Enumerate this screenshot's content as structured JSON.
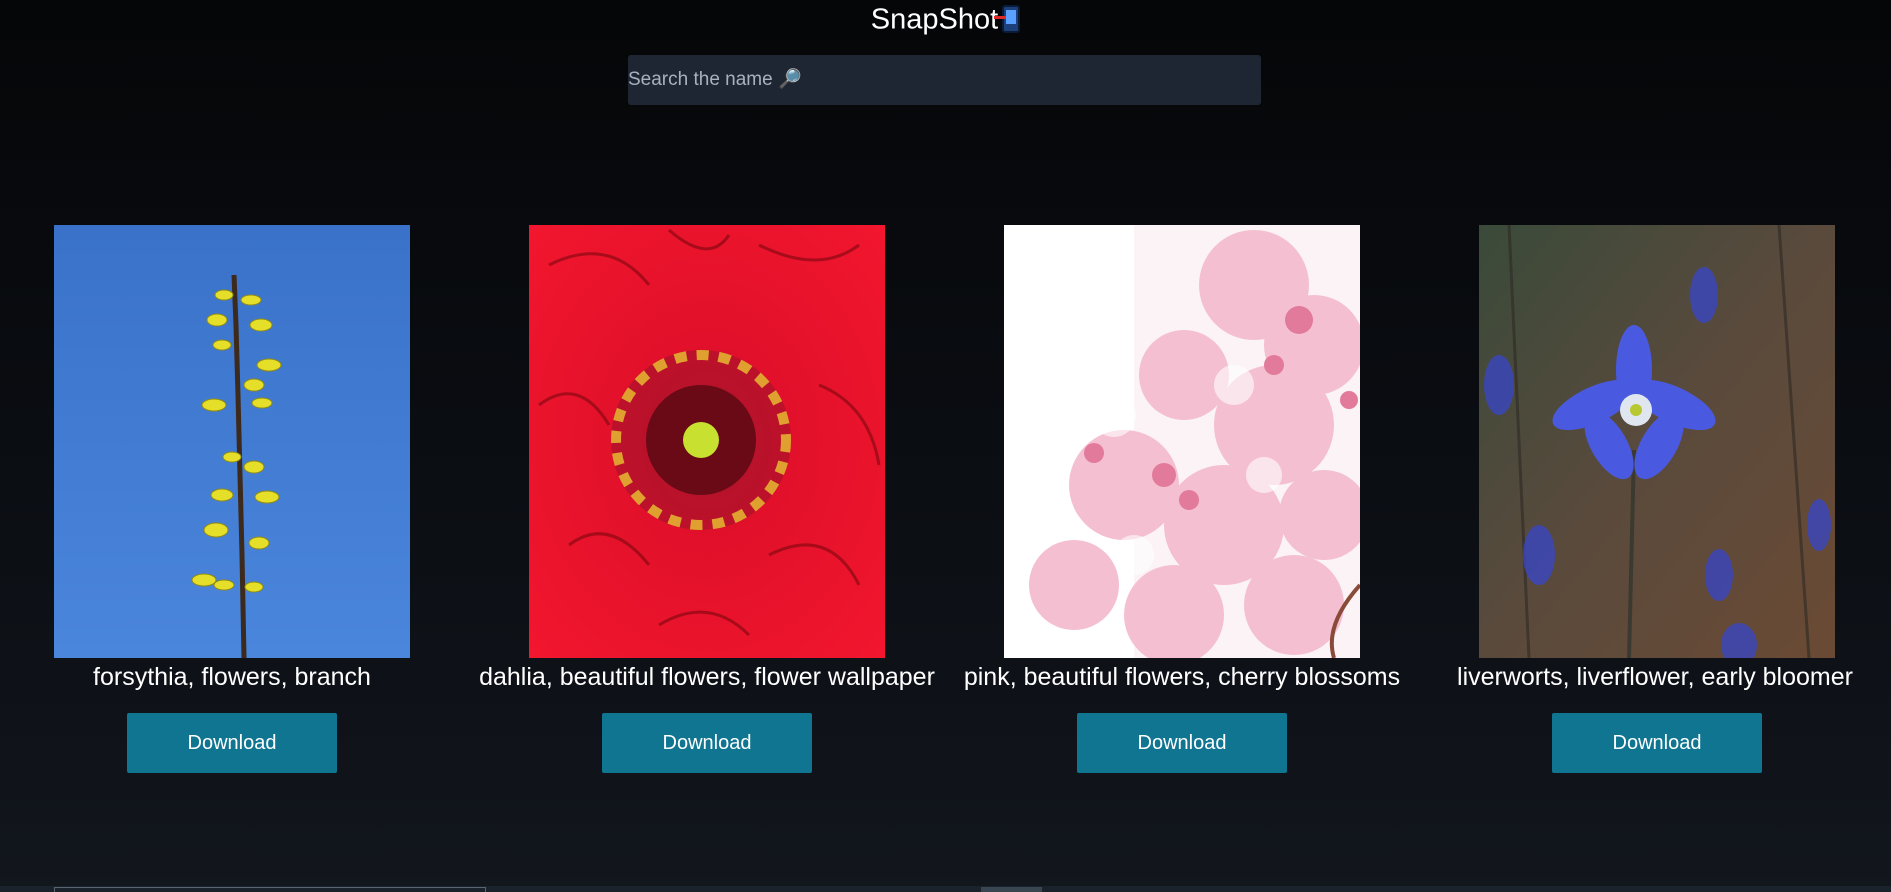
{
  "app": {
    "title": "SnapShot",
    "title_icon": "mobile-phone-arrow-icon"
  },
  "search": {
    "placeholder": "Search the name 🔎",
    "value": ""
  },
  "gallery": {
    "items": [
      {
        "caption": "forsythia, flowers, branch",
        "button_label": "Download",
        "image": "forsythia-photo"
      },
      {
        "caption": "dahlia, beautiful flowers, flower wallpaper",
        "button_label": "Download",
        "image": "dahlia-photo"
      },
      {
        "caption": "pink, beautiful flowers, cherry blossoms",
        "button_label": "Download",
        "image": "cherry-blossom-photo"
      },
      {
        "caption": "liverworts, liverflower, early bloomer",
        "button_label": "Download",
        "image": "liverwort-photo"
      }
    ]
  },
  "colors": {
    "background": "#07090c",
    "search_bg": "#1f2633",
    "button_bg": "#0f7591",
    "text": "#ffffff"
  }
}
